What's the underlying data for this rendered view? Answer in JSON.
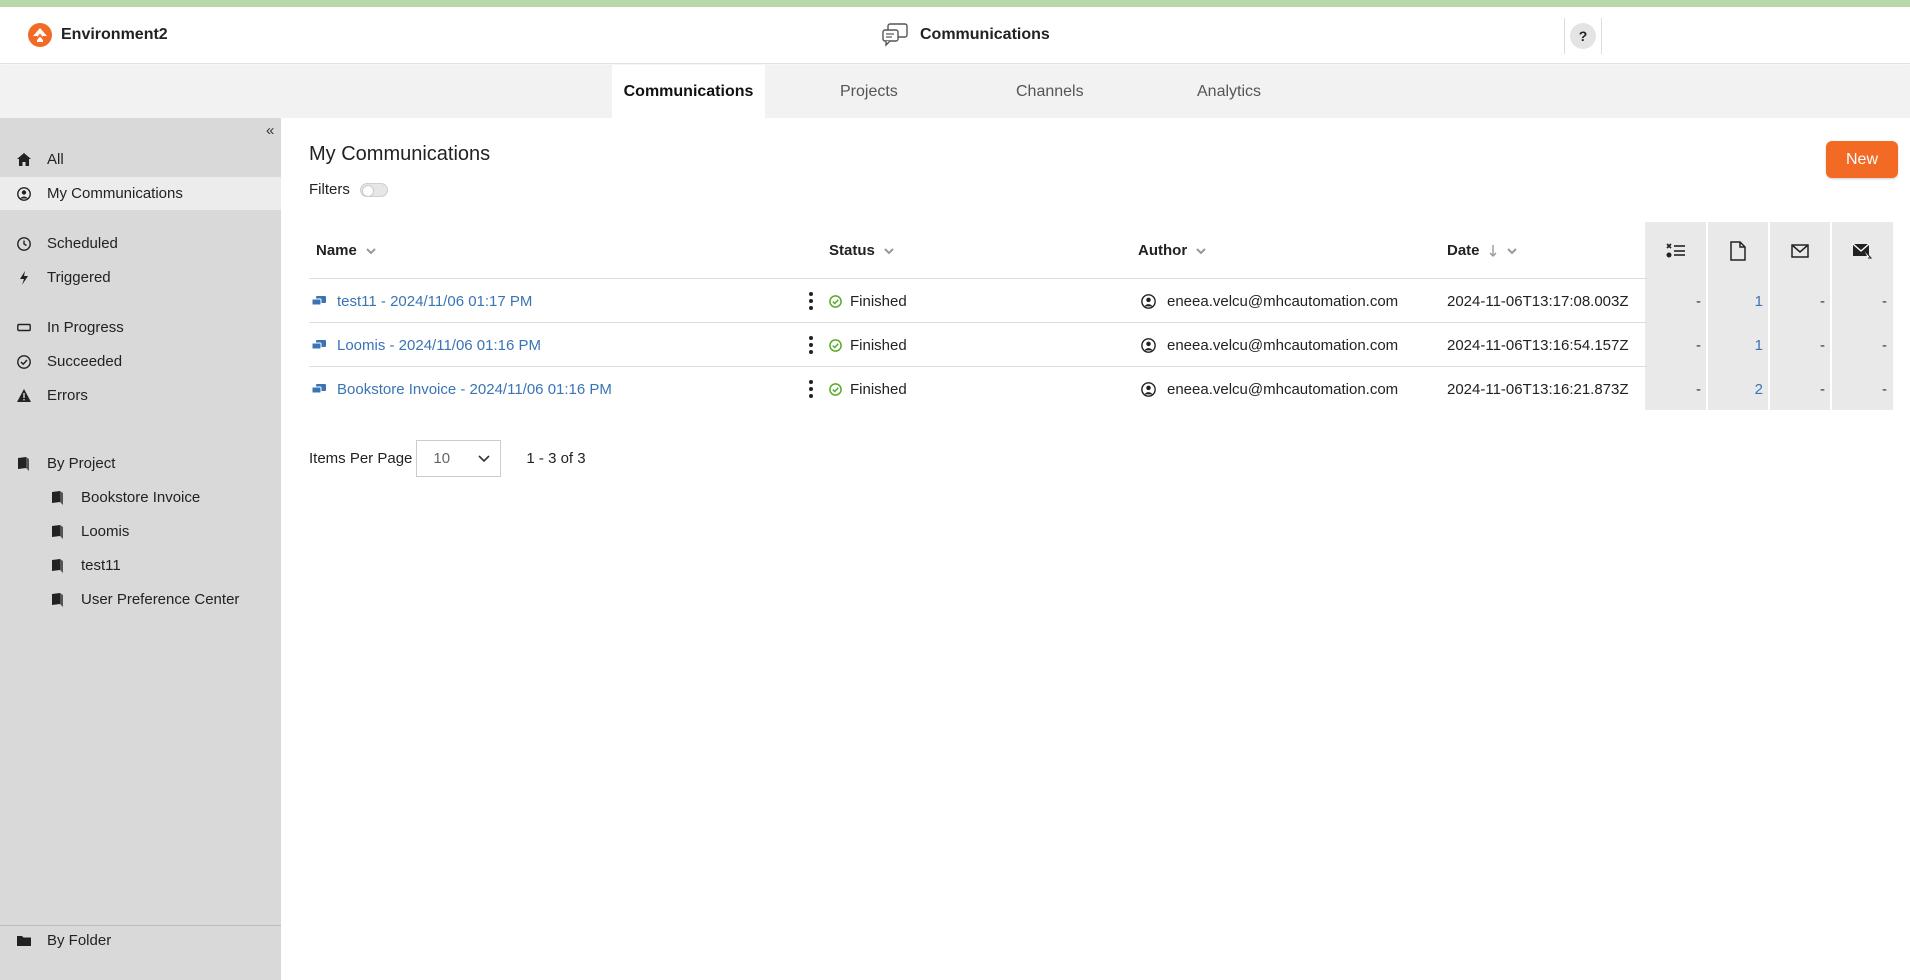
{
  "header": {
    "env_name": "Environment2",
    "app_title": "Communications",
    "help_label": "?"
  },
  "tabs": [
    "Communications",
    "Projects",
    "Channels",
    "Analytics"
  ],
  "sidebar": {
    "collapse_label": "«",
    "items": [
      {
        "label": "All",
        "icon": "home-icon"
      },
      {
        "label": "My Communications",
        "icon": "user-circle-icon"
      },
      {
        "label": "Scheduled",
        "icon": "clock-icon"
      },
      {
        "label": "Triggered",
        "icon": "bolt-icon"
      },
      {
        "label": "In Progress",
        "icon": "progress-icon"
      },
      {
        "label": "Succeeded",
        "icon": "check-circle-icon"
      },
      {
        "label": "Errors",
        "icon": "warning-icon"
      },
      {
        "label": "By Project",
        "icon": "book-icon"
      }
    ],
    "projects": [
      "Bookstore Invoice",
      "Loomis",
      "test11",
      "User Preference Center"
    ],
    "by_folder": "By Folder"
  },
  "main": {
    "title": "My Communications",
    "filters_label": "Filters",
    "new_label": "New"
  },
  "table": {
    "columns": {
      "name": "Name",
      "status": "Status",
      "author": "Author",
      "date": "Date"
    },
    "rows": [
      {
        "name": "test11 - 2024/11/06 01:17 PM",
        "status": "Finished",
        "author": "eneea.velcu@mhcautomation.com",
        "date": "2024-11-06T13:17:08.003Z",
        "m1": "-",
        "m2": "1",
        "m3": "-",
        "m4": "-"
      },
      {
        "name": "Loomis - 2024/11/06 01:16 PM",
        "status": "Finished",
        "author": "eneea.velcu@mhcautomation.com",
        "date": "2024-11-06T13:16:54.157Z",
        "m1": "-",
        "m2": "1",
        "m3": "-",
        "m4": "-"
      },
      {
        "name": "Bookstore Invoice - 2024/11/06 01:16 PM",
        "status": "Finished",
        "author": "eneea.velcu@mhcautomation.com",
        "date": "2024-11-06T13:16:21.873Z",
        "m1": "-",
        "m2": "2",
        "m3": "-",
        "m4": "-"
      }
    ]
  },
  "pagination": {
    "items_per_page_label": "Items Per Page",
    "items_per_page_value": "10",
    "range": "1 - 3 of 3"
  },
  "colors": {
    "accent": "#f26a23",
    "link": "#3a74b4",
    "success": "#5aac2e"
  }
}
